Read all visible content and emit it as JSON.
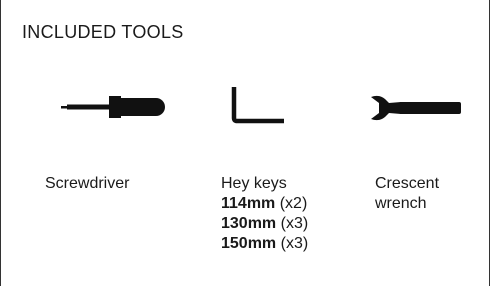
{
  "section": {
    "title": "INCLUDED TOOLS"
  },
  "tools": [
    {
      "icon": "screwdriver-icon",
      "name": "Screwdriver"
    },
    {
      "icon": "hex-key-icon",
      "name": "Hey keys",
      "sizes": [
        {
          "size": "114mm",
          "qty": "(x2)"
        },
        {
          "size": "130mm",
          "qty": "(x3)"
        },
        {
          "size": "150mm",
          "qty": "(x3)"
        }
      ]
    },
    {
      "icon": "wrench-icon",
      "name_line1": "Crescent",
      "name_line2": "wrench"
    }
  ]
}
